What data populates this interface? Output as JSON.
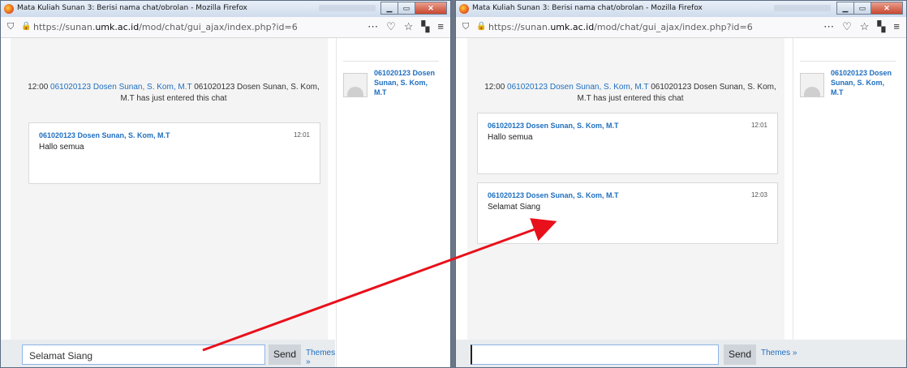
{
  "window_title": "Mata Kuliah Sunan 3: Berisi nama chat/obrolan - Mozilla Firefox",
  "url_prefix": "https://sunan.",
  "url_domain": "umk.ac.id",
  "url_path": "/mod/chat/gui_ajax/index.php?id=6",
  "system_message": {
    "time": "12:00",
    "user": "061020123 Dosen Sunan, S. Kom, M.T",
    "text": "061020123 Dosen Sunan, S. Kom, M.T has just entered this chat"
  },
  "messages": [
    {
      "name": "061020123 Dosen Sunan, S. Kom, M.T",
      "time": "12:01",
      "text": "Hallo semua"
    },
    {
      "name": "061020123 Dosen Sunan, S. Kom, M.T",
      "time": "12:03",
      "text": "Selamat Siang"
    }
  ],
  "user_list": [
    {
      "name": "061020123 Dosen Sunan, S. Kom, M.T"
    }
  ],
  "left_input_value": "Selamat Siang",
  "right_input_value": "",
  "send_label": "Send",
  "themes_label": "Themes »",
  "colors": {
    "link": "#1f6fbf",
    "arrow": "#e8101a",
    "close": "#c8462f"
  }
}
